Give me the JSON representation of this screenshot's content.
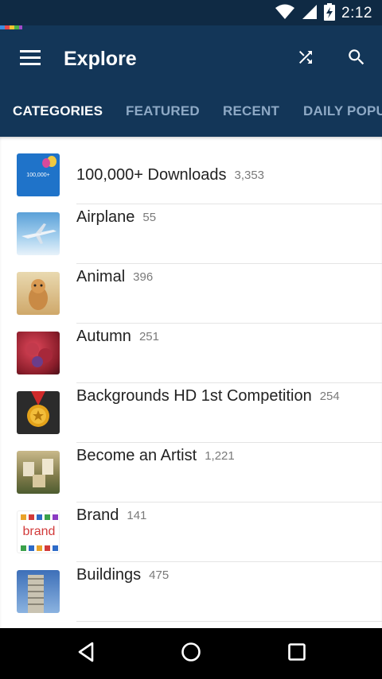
{
  "status_bar": {
    "time": "2:12",
    "icons": [
      "wifi-icon",
      "cell-signal-icon",
      "battery-charging-icon"
    ]
  },
  "app_bar": {
    "title": "Explore",
    "menu_icon": "hamburger-menu-icon",
    "shuffle_icon": "shuffle-icon",
    "search_icon": "search-icon"
  },
  "tabs": [
    {
      "label": "CATEGORIES",
      "active": true
    },
    {
      "label": "FEATURED",
      "active": false
    },
    {
      "label": "RECENT",
      "active": false
    },
    {
      "label": "DAILY POPU",
      "active": false
    }
  ],
  "categories": [
    {
      "name": "100,000+ Downloads",
      "count": "3,353",
      "thumb_text": "100,000+"
    },
    {
      "name": "Airplane",
      "count": "55"
    },
    {
      "name": "Animal",
      "count": "396"
    },
    {
      "name": "Autumn",
      "count": "251"
    },
    {
      "name": "Backgrounds HD 1st Competition",
      "count": "254"
    },
    {
      "name": "Become an Artist",
      "count": "1,221"
    },
    {
      "name": "Brand",
      "count": "141",
      "thumb_text": "brand"
    },
    {
      "name": "Buildings",
      "count": "475"
    }
  ],
  "nav_bar": {
    "icons": [
      "back-icon",
      "home-icon",
      "recents-icon"
    ]
  },
  "colors": {
    "status_bar": "#0f2a44",
    "app_bar": "#133658",
    "tab_inactive": "#8ea9c5",
    "accent": "#ffffff"
  }
}
